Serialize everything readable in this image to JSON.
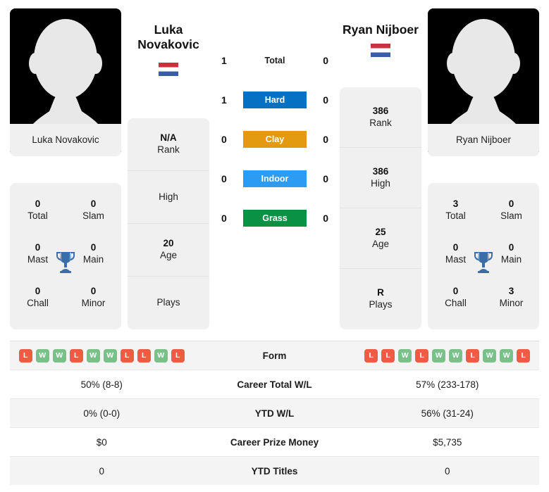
{
  "players": {
    "left": {
      "name": "Luka Novakovic",
      "display_name_line1": "Luka",
      "display_name_line2": "Novakovic",
      "country_flag": "nl-flag-icon",
      "rank": "N/A",
      "rank_label": "Rank",
      "high": "",
      "high_label": "High",
      "age": "20",
      "age_label": "Age",
      "plays": "",
      "plays_label": "Plays",
      "titles": {
        "total": "0",
        "total_label": "Total",
        "slam": "0",
        "slam_label": "Slam",
        "mast": "0",
        "mast_label": "Mast",
        "main": "0",
        "main_label": "Main",
        "chall": "0",
        "chall_label": "Chall",
        "minor": "0",
        "minor_label": "Minor"
      },
      "form": [
        "L",
        "W",
        "W",
        "L",
        "W",
        "W",
        "L",
        "L",
        "W",
        "L"
      ],
      "career_total_wl": "50% (8-8)",
      "ytd_wl": "0% (0-0)",
      "career_prize_money": "$0",
      "ytd_titles": "0"
    },
    "right": {
      "name": "Ryan Nijboer",
      "display_name_line1": "Ryan Nijboer",
      "display_name_line2": "",
      "country_flag": "nl-flag-icon",
      "rank": "386",
      "rank_label": "Rank",
      "high": "386",
      "high_label": "High",
      "age": "25",
      "age_label": "Age",
      "plays": "R",
      "plays_label": "Plays",
      "titles": {
        "total": "3",
        "total_label": "Total",
        "slam": "0",
        "slam_label": "Slam",
        "mast": "0",
        "mast_label": "Mast",
        "main": "0",
        "main_label": "Main",
        "chall": "0",
        "chall_label": "Chall",
        "minor": "3",
        "minor_label": "Minor"
      },
      "form": [
        "L",
        "L",
        "W",
        "L",
        "W",
        "W",
        "L",
        "W",
        "W",
        "L"
      ],
      "career_total_wl": "57% (233-178)",
      "ytd_wl": "56% (31-24)",
      "career_prize_money": "$5,735",
      "ytd_titles": "0"
    }
  },
  "head_to_head": {
    "rows": [
      {
        "label": "Total",
        "left": "1",
        "right": "0",
        "color": "",
        "plain": true
      },
      {
        "label": "Hard",
        "left": "1",
        "right": "0",
        "color": "#0671c0",
        "plain": false
      },
      {
        "label": "Clay",
        "left": "0",
        "right": "0",
        "color": "#e39a10",
        "plain": false
      },
      {
        "label": "Indoor",
        "left": "0",
        "right": "0",
        "color": "#2b9bf4",
        "plain": false
      },
      {
        "label": "Grass",
        "left": "0",
        "right": "0",
        "color": "#0b9143",
        "plain": false
      }
    ]
  },
  "comparison_table": {
    "rows": [
      {
        "label": "Form",
        "type": "form",
        "left": "",
        "right": ""
      },
      {
        "label": "Career Total W/L",
        "type": "text",
        "left": "50% (8-8)",
        "right": "57% (233-178)"
      },
      {
        "label": "YTD W/L",
        "type": "text",
        "left": "0% (0-0)",
        "right": "56% (31-24)"
      },
      {
        "label": "Career Prize Money",
        "type": "text",
        "left": "$0",
        "right": "$5,735"
      },
      {
        "label": "YTD Titles",
        "type": "text",
        "left": "0",
        "right": "0"
      }
    ]
  },
  "colors": {
    "hard": "#0671c0",
    "clay": "#e39a10",
    "indoor": "#2b9bf4",
    "grass": "#0b9143",
    "win_badge": "#79c188",
    "loss_badge": "#ef5b43",
    "card_bg": "#f0f0f0",
    "trophy": "#3a6ea8"
  }
}
